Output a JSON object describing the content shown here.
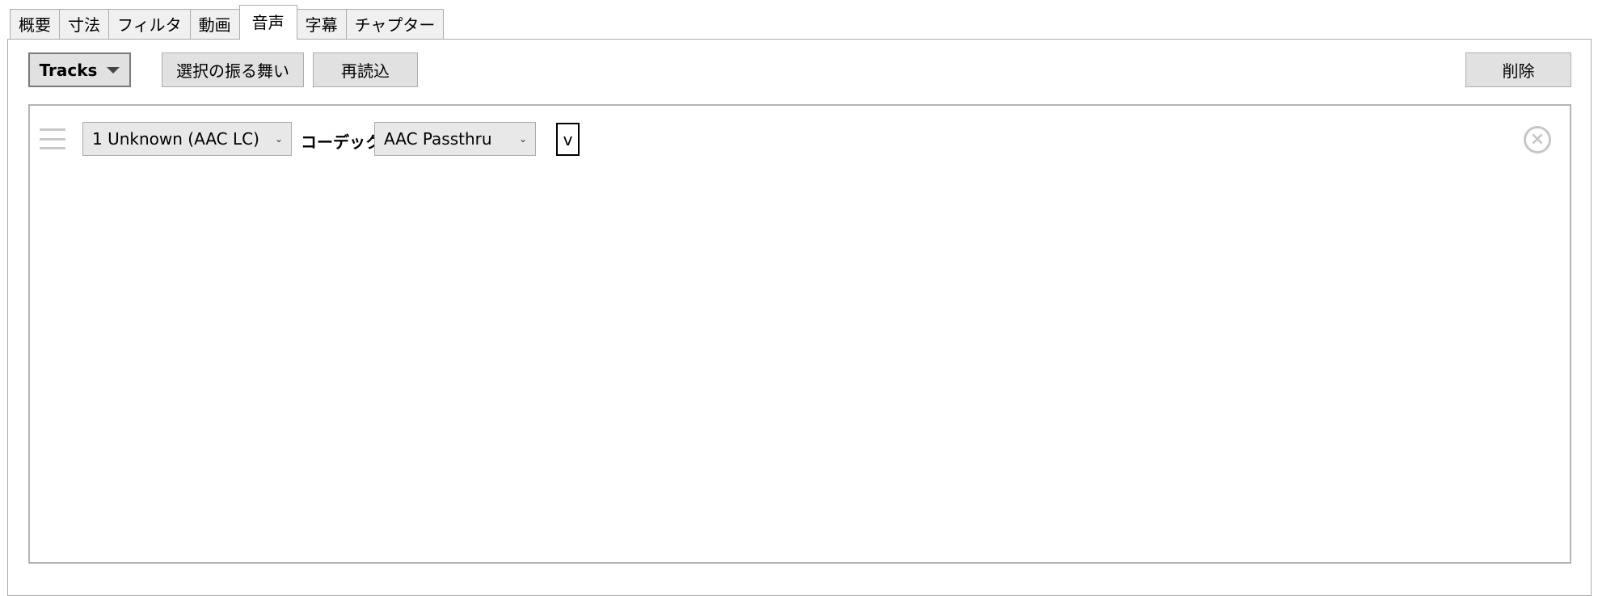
{
  "tabs": [
    {
      "label": "概要"
    },
    {
      "label": "寸法"
    },
    {
      "label": "フィルタ"
    },
    {
      "label": "動画"
    },
    {
      "label": "音声",
      "active": true
    },
    {
      "label": "字幕"
    },
    {
      "label": "チャプター"
    }
  ],
  "toolbar": {
    "tracks_label": "Tracks",
    "behavior_label": "選択の振る舞い",
    "reload_label": "再読込",
    "remove_label": "削除"
  },
  "track": {
    "source_value": "1 Unknown (AAC LC)",
    "codec_label": "コーデック",
    "codec_value": "AAC Passthru",
    "toggle_text": "v"
  },
  "icons": {
    "drag": "drag-handle-icon",
    "remove": "close-circle-icon",
    "dropdown": "chevron-down-icon",
    "caret": "caret-down-icon"
  }
}
